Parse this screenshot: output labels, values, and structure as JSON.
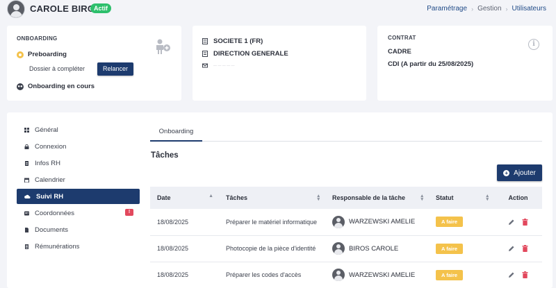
{
  "header": {
    "user_name": "CAROLE BIROS",
    "status": "Actif",
    "breadcrumb": [
      "Paramétrage",
      "Gestion",
      "Utilisateurs"
    ]
  },
  "onboarding_card": {
    "title": "ONBOARDING",
    "step1": "Preboarding",
    "step1_sub": "Dossier à compléter",
    "relaunch_button": "Relancer",
    "step2": "Onboarding en cours"
  },
  "org_card": {
    "company": "SOCIETE 1 (FR)",
    "department": "DIRECTION GENERALE",
    "email_masked": "— — — — —"
  },
  "contract_card": {
    "title": "CONTRAT",
    "position": "CADRE",
    "contract_type": "CDI (A partir du 25/08/2025)"
  },
  "sidebar": {
    "items": [
      {
        "label": "Général",
        "icon": "grid-icon"
      },
      {
        "label": "Connexion",
        "icon": "lock-icon"
      },
      {
        "label": "Infos RH",
        "icon": "document-icon"
      },
      {
        "label": "Calendrier",
        "icon": "calendar-icon"
      },
      {
        "label": "Suivi RH",
        "icon": "cloud-icon",
        "active": true
      },
      {
        "label": "Coordonnées",
        "icon": "contact-icon",
        "badge": "!"
      },
      {
        "label": "Documents",
        "icon": "file-icon"
      },
      {
        "label": "Rémunérations",
        "icon": "money-icon"
      }
    ]
  },
  "tabs": [
    {
      "label": "Onboarding",
      "active": true
    }
  ],
  "tasks": {
    "title": "Tâches",
    "add_button": "Ajouter",
    "columns": [
      "Date",
      "Tâches",
      "Responsable de la tâche",
      "Statut",
      "Action"
    ],
    "rows": [
      {
        "date": "18/08/2025",
        "task": "Préparer le matériel informatique",
        "owner": "WARZEWSKI AMELIE",
        "status": "A faire"
      },
      {
        "date": "18/08/2025",
        "task": "Photocopie de la pièce d'identité",
        "owner": "BIROS CAROLE",
        "status": "A faire"
      },
      {
        "date": "18/08/2025",
        "task": "Préparer les codes d'accès",
        "owner": "WARZEWSKI AMELIE",
        "status": "A faire"
      }
    ]
  },
  "colors": {
    "primary": "#1d3b6e",
    "status_todo": "#f4c24b",
    "active_badge": "#2dbf6c",
    "alert": "#e2485d",
    "delete": "#e2485d"
  }
}
